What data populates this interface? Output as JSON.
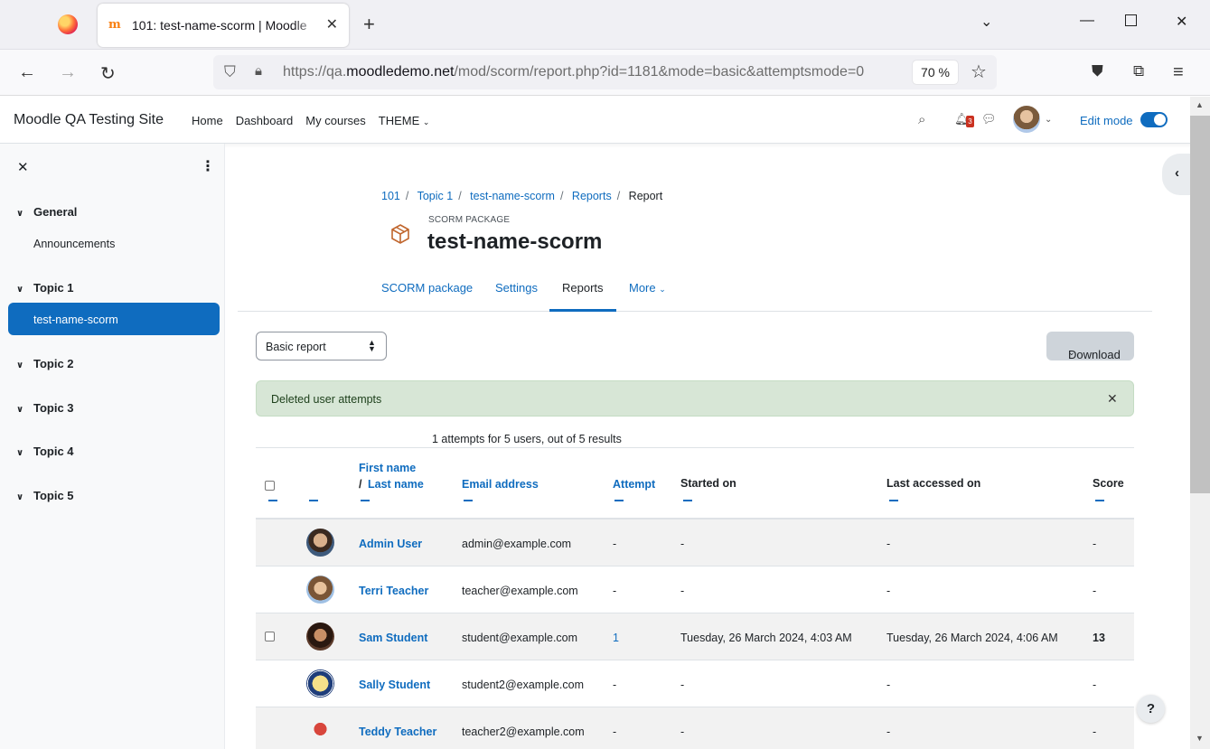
{
  "browser": {
    "tab_title": "101: test-name-scorm | Moodle",
    "url_prefix": "https://qa.",
    "url_domain": "moodledemo.net",
    "url_path": "/mod/scorm/report.php?id=1181&mode=basic&attemptsmode=0",
    "zoom": "70 %"
  },
  "header": {
    "site_name": "Moodle QA Testing Site",
    "nav": [
      "Home",
      "Dashboard",
      "My courses",
      "THEME"
    ],
    "notification_count": "3",
    "edit_mode_label": "Edit mode",
    "edit_mode_on": true
  },
  "drawer": {
    "sections": [
      {
        "label": "General",
        "items": [
          "Announcements"
        ]
      },
      {
        "label": "Topic 1",
        "items": [
          "test-name-scorm"
        ]
      },
      {
        "label": "Topic 2",
        "items": []
      },
      {
        "label": "Topic 3",
        "items": []
      },
      {
        "label": "Topic 4",
        "items": []
      },
      {
        "label": "Topic 5",
        "items": []
      }
    ],
    "active_item": "test-name-scorm"
  },
  "breadcrumb": [
    "101",
    "Topic 1",
    "test-name-scorm",
    "Reports",
    "Report"
  ],
  "page": {
    "module_label": "SCORM PACKAGE",
    "title": "test-name-scorm"
  },
  "secondary_nav": {
    "tabs": [
      "SCORM package",
      "Settings",
      "Reports",
      "More"
    ],
    "active": "Reports"
  },
  "report_select": {
    "value": "Basic report"
  },
  "download_label": "Download",
  "alert": {
    "message": "Deleted user attempts"
  },
  "summary": "1 attempts for 5 users, out of 5 results",
  "table": {
    "headers": {
      "first_name": "First name",
      "slash": "/",
      "last_name": "Last name",
      "email": "Email address",
      "attempt": "Attempt",
      "started": "Started on",
      "last_accessed": "Last accessed on",
      "score": "Score"
    },
    "rows": [
      {
        "name": "Admin User",
        "email": "admin@example.com",
        "attempt": "-",
        "started": "-",
        "last_accessed": "-",
        "score": "-",
        "checkbox": false
      },
      {
        "name": "Terri Teacher",
        "email": "teacher@example.com",
        "attempt": "-",
        "started": "-",
        "last_accessed": "-",
        "score": "-",
        "checkbox": false
      },
      {
        "name": "Sam Student",
        "email": "student@example.com",
        "attempt": "1",
        "started": "Tuesday, 26 March 2024, 4:03 AM",
        "last_accessed": "Tuesday, 26 March 2024, 4:06 AM",
        "score": "13",
        "checkbox": true
      },
      {
        "name": "Sally Student",
        "email": "student2@example.com",
        "attempt": "-",
        "started": "-",
        "last_accessed": "-",
        "score": "-",
        "checkbox": false
      },
      {
        "name": "Teddy Teacher",
        "email": "teacher2@example.com",
        "attempt": "-",
        "started": "-",
        "last_accessed": "-",
        "score": "-",
        "checkbox": false
      }
    ]
  },
  "help_label": "?",
  "colors": {
    "accent": "#0f6cbf",
    "alert_bg": "#d7e6d6"
  }
}
